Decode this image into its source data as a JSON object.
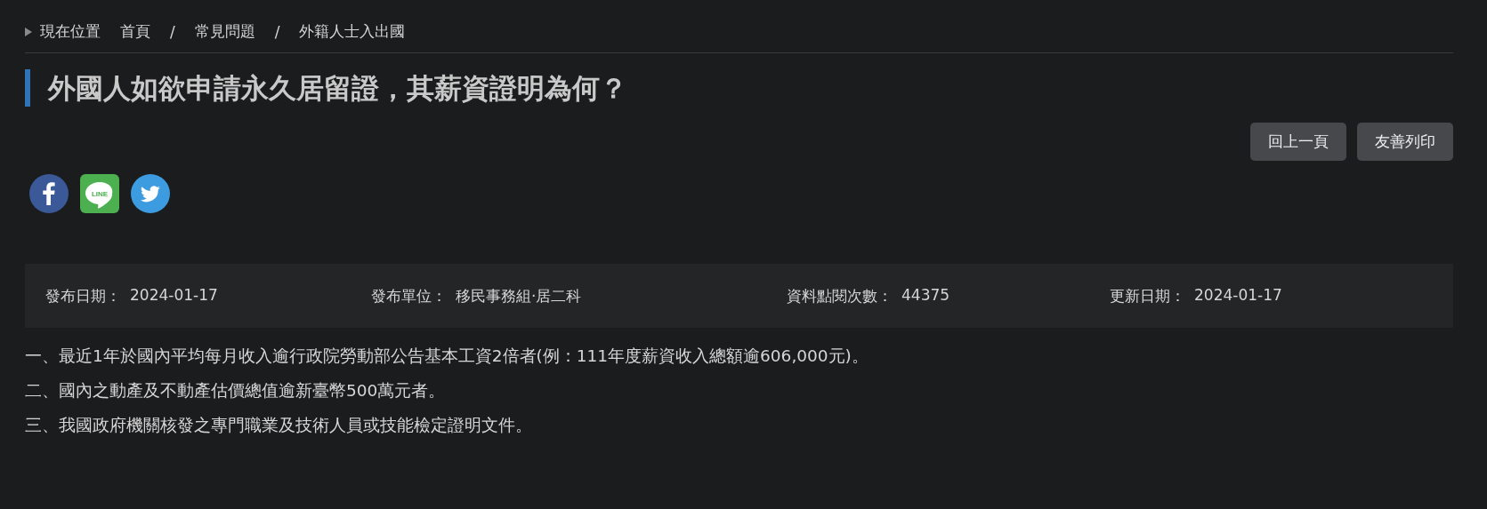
{
  "breadcrumb": {
    "label": "現在位置",
    "items": [
      "首頁",
      "常見問題",
      "外籍人士入出國"
    ],
    "separator": "/"
  },
  "title": "外國人如欲申請永久居留證，其薪資證明為何？",
  "buttons": [
    "回上一頁",
    "友善列印"
  ],
  "share": [
    {
      "kind": "facebook"
    },
    {
      "kind": "line",
      "text": "LINE"
    },
    {
      "kind": "twitter"
    }
  ],
  "meta": [
    {
      "label": "發布日期：",
      "value": "2024-01-17"
    },
    {
      "label": "發布單位：",
      "value": "移民事務組‧居二科"
    },
    {
      "label": "資料點閱次數：",
      "value": "44375"
    },
    {
      "label": "更新日期：",
      "value": "2024-01-17"
    }
  ],
  "paragraphs": [
    "一、最近1年於國內平均每月收入逾行政院勞動部公告基本工資2倍者(例：111年度薪資收入總額逾606,000元)。",
    "二、國內之動產及不動產估價總值逾新臺幣500萬元者。",
    "三、我國政府機關核發之專門職業及技術人員或技能檢定證明文件。"
  ]
}
